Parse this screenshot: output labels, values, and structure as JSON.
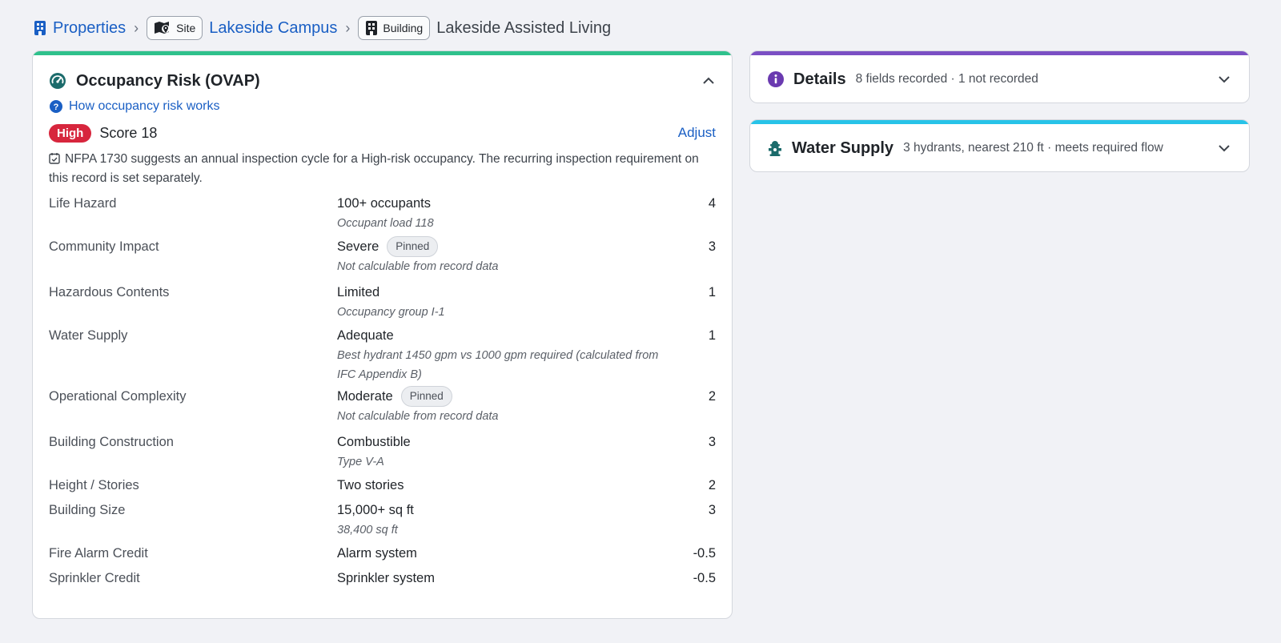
{
  "breadcrumb": {
    "root": "Properties",
    "site_chip": "Site",
    "site_name": "Lakeside Campus",
    "building_chip": "Building",
    "building_name": "Lakeside Assisted Living"
  },
  "risk": {
    "title": "Occupancy Risk (OVAP)",
    "help_link": "How occupancy risk works",
    "level": "High",
    "score": "Score 18",
    "adjust": "Adjust",
    "note": "NFPA 1730 suggests an annual inspection cycle for a High-risk occupancy. The recurring inspection requirement on this record is set separately.",
    "rows": [
      {
        "label": "Life Hazard",
        "value": "100+ occupants",
        "pinned": "",
        "sub": "Occupant load 118",
        "score": "4"
      },
      {
        "label": "Community Impact",
        "value": "Severe",
        "pinned": "Pinned",
        "sub": "Not calculable from record data",
        "score": "3"
      },
      {
        "label": "Hazardous Contents",
        "value": "Limited",
        "pinned": "",
        "sub": "Occupancy group I-1",
        "score": "1"
      },
      {
        "label": "Water Supply",
        "value": "Adequate",
        "pinned": "",
        "sub": "Best hydrant 1450 gpm vs 1000 gpm required (calculated from IFC Appendix B)",
        "score": "1"
      },
      {
        "label": "Operational Complexity",
        "value": "Moderate",
        "pinned": "Pinned",
        "sub": "Not calculable from record data",
        "score": "2"
      },
      {
        "label": "Building Construction",
        "value": "Combustible",
        "pinned": "",
        "sub": "Type V-A",
        "score": "3"
      },
      {
        "label": "Height / Stories",
        "value": "Two stories",
        "pinned": "",
        "sub": "",
        "score": "2"
      },
      {
        "label": "Building Size",
        "value": "15,000+ sq ft",
        "pinned": "",
        "sub": "38,400 sq ft",
        "score": "3"
      },
      {
        "label": "Fire Alarm Credit",
        "value": "Alarm system",
        "pinned": "",
        "sub": "",
        "score": "-0.5"
      },
      {
        "label": "Sprinkler Credit",
        "value": "Sprinkler system",
        "pinned": "",
        "sub": "",
        "score": "-0.5"
      }
    ]
  },
  "details": {
    "title": "Details",
    "summary": "8 fields recorded · 1 not recorded"
  },
  "water_supply": {
    "title": "Water Supply",
    "summary": "3 hydrants, nearest 210 ft · meets required flow"
  },
  "colors": {
    "risk_bar": "#2fc18c",
    "details_bar": "#7b4fc4",
    "water_bar": "#27c3e8",
    "link": "#1a5fc4",
    "high_badge": "#d7263d"
  },
  "icons": {
    "properties": "building-icon",
    "site": "map-pin-icon",
    "building": "building-icon",
    "risk": "gauge-icon",
    "help": "question-circle-icon",
    "note": "calendar-check-icon",
    "details": "info-circle-icon",
    "water": "hydrant-icon"
  }
}
